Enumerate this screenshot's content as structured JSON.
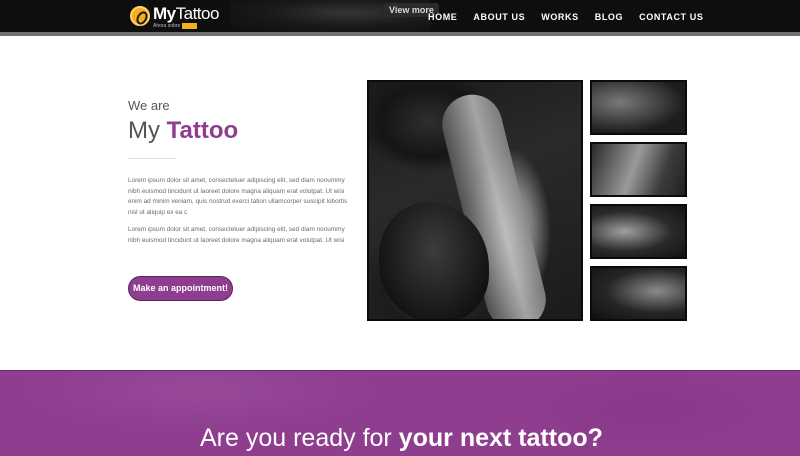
{
  "header": {
    "logo_word_bold": "My",
    "logo_word_light": "Tattoo",
    "logo_tagline": "Ahora sobre",
    "logo_badge": "",
    "view_more": "View more",
    "nav": [
      "HOME",
      "ABOUT US",
      "WORKS",
      "BLOG",
      "CONTACT US"
    ]
  },
  "intro": {
    "we_are": "We are",
    "title_plain": "My ",
    "title_strong": "Tattoo",
    "paragraph_1": "Lorem ipsum dolor sit amet, consectetuer adipiscing elit, sed diam nonummy nibh euismod tincidunt ut laoreet dolore magna aliquam erat volutpat. Ut wisi enim ad minim veniam, quis nostrud exerci tation ullamcorper suscipit lobortis nisl ut aliquip ex ea c",
    "paragraph_2": "Lorem ipsum dolor sit amet, consectetuer adipiscing elit, sed diam nonummy nibh euismod tincidunt ut laoreet dolore magna aliquam erat volutpat. Ut wisi",
    "cta": "Make an appointment!"
  },
  "banner": {
    "text_plain": "Are you ready for ",
    "text_strong": "your next tattoo?"
  },
  "colors": {
    "accent": "#8e3d8f",
    "logo_gold": "#f2b01e",
    "topbar": "#0e0e0e"
  }
}
